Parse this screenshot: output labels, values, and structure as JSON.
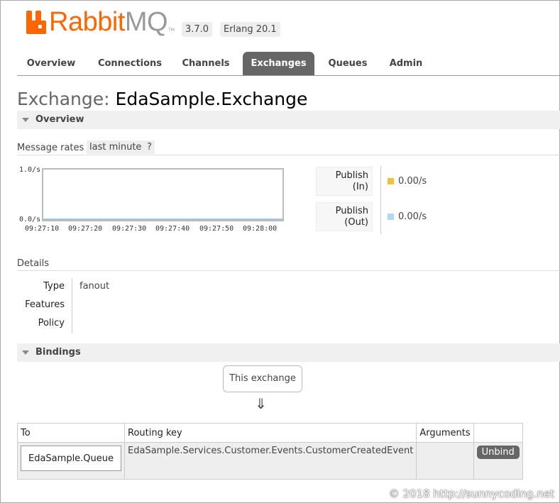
{
  "brand": {
    "rabbit": "Rabbit",
    "mq": "MQ",
    "tm": "TM"
  },
  "versions": {
    "rabbitmq": "3.7.0",
    "erlang": "Erlang 20.1"
  },
  "tabs": [
    "Overview",
    "Connections",
    "Channels",
    "Exchanges",
    "Queues",
    "Admin"
  ],
  "active_tab": "Exchanges",
  "page": {
    "title_prefix": "Exchange:",
    "title_name": "EdaSample.Exchange"
  },
  "overview": {
    "section_label": "Overview",
    "rates_label": "Message rates",
    "range_label": "last minute",
    "help_label": "?"
  },
  "rate_chart": {
    "y_top": "1.0/s",
    "y_bottom": "0.0/s",
    "x_ticks": [
      "09:27:10",
      "09:27:20",
      "09:27:30",
      "09:27:40",
      "09:27:50",
      "09:28:00"
    ],
    "series": [
      {
        "name_line1": "Publish",
        "name_line2": "(In)",
        "value": "0.00/s",
        "color": "#edc240"
      },
      {
        "name_line1": "Publish",
        "name_line2": "(Out)",
        "value": "0.00/s",
        "color": "#afd8f8"
      }
    ]
  },
  "details": {
    "section_label": "Details",
    "rows": [
      {
        "key": "Type",
        "value": "fanout"
      },
      {
        "key": "Features",
        "value": ""
      },
      {
        "key": "Policy",
        "value": ""
      }
    ]
  },
  "bindings": {
    "section_label": "Bindings",
    "source_label": "This exchange",
    "arrow": "⇓",
    "columns": {
      "to": "To",
      "routing_key": "Routing key",
      "arguments": "Arguments"
    },
    "rows": [
      {
        "to": "EdaSample.Queue",
        "routing_key": "EdaSample.Services.Customer.Events.CustomerCreatedEvent",
        "arguments": "",
        "action": "Unbind"
      }
    ]
  },
  "watermark": "© 2018 http://sunnycoding.net"
}
